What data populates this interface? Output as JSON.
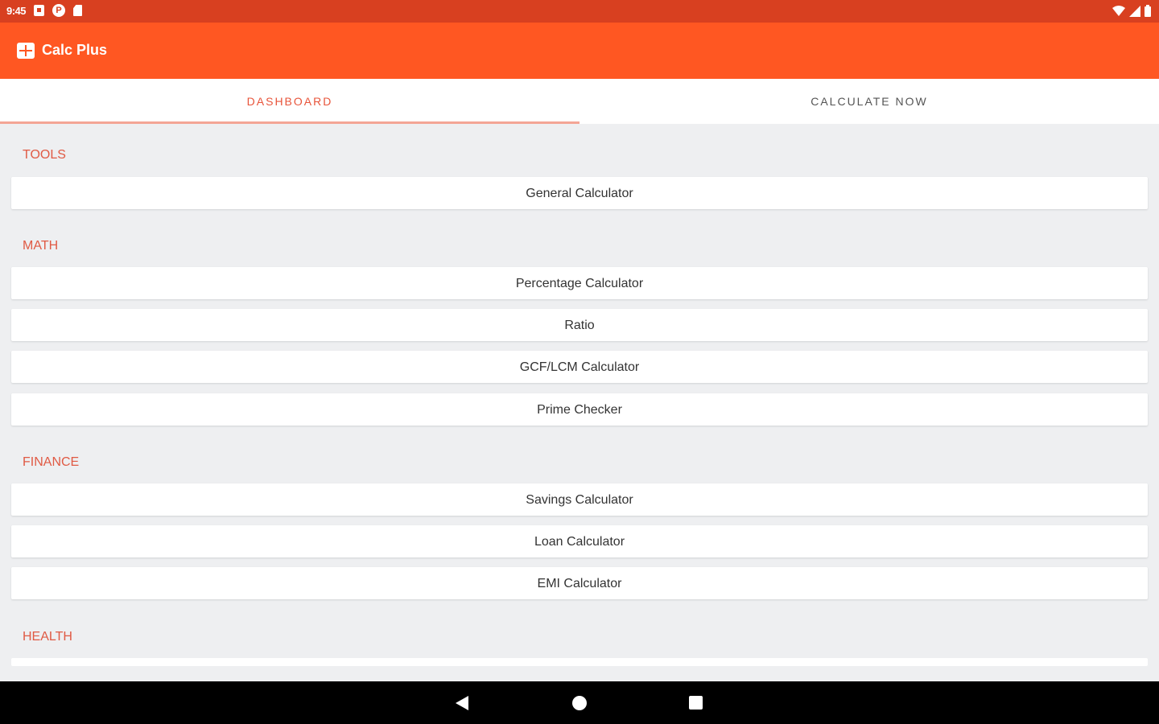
{
  "status_bar": {
    "time": "9:45",
    "left_icons": [
      "notification-square-icon",
      "p-circle-icon",
      "sd-card-icon"
    ],
    "p_icon_letter": "P",
    "right_icons": [
      "wifi-icon",
      "signal-icon",
      "battery-icon"
    ]
  },
  "app_bar": {
    "title": "Calc Plus",
    "logo_icon": "calculator-icon",
    "color": "#ff5722"
  },
  "tabs": {
    "dashboard": "DASHBOARD",
    "calculate_now": "CALCULATE NOW",
    "selected": "DASHBOARD"
  },
  "sections": {
    "tools": {
      "header": "TOOLS",
      "items": [
        "General Calculator"
      ]
    },
    "math": {
      "header": "MATH",
      "items": [
        "Percentage Calculator",
        "Ratio",
        "GCF/LCM Calculator",
        "Prime Checker"
      ]
    },
    "finance": {
      "header": "FINANCE",
      "items": [
        "Savings Calculator",
        "Loan Calculator",
        "EMI Calculator"
      ]
    },
    "health": {
      "header": "HEALTH"
    }
  },
  "nav_bar": {
    "icons": [
      "back-icon",
      "home-icon",
      "recents-icon"
    ]
  },
  "colors": {
    "status_bar": "#d84020",
    "accent": "#ff5722",
    "section_header": "#e05a44",
    "background": "#eeeff1"
  }
}
